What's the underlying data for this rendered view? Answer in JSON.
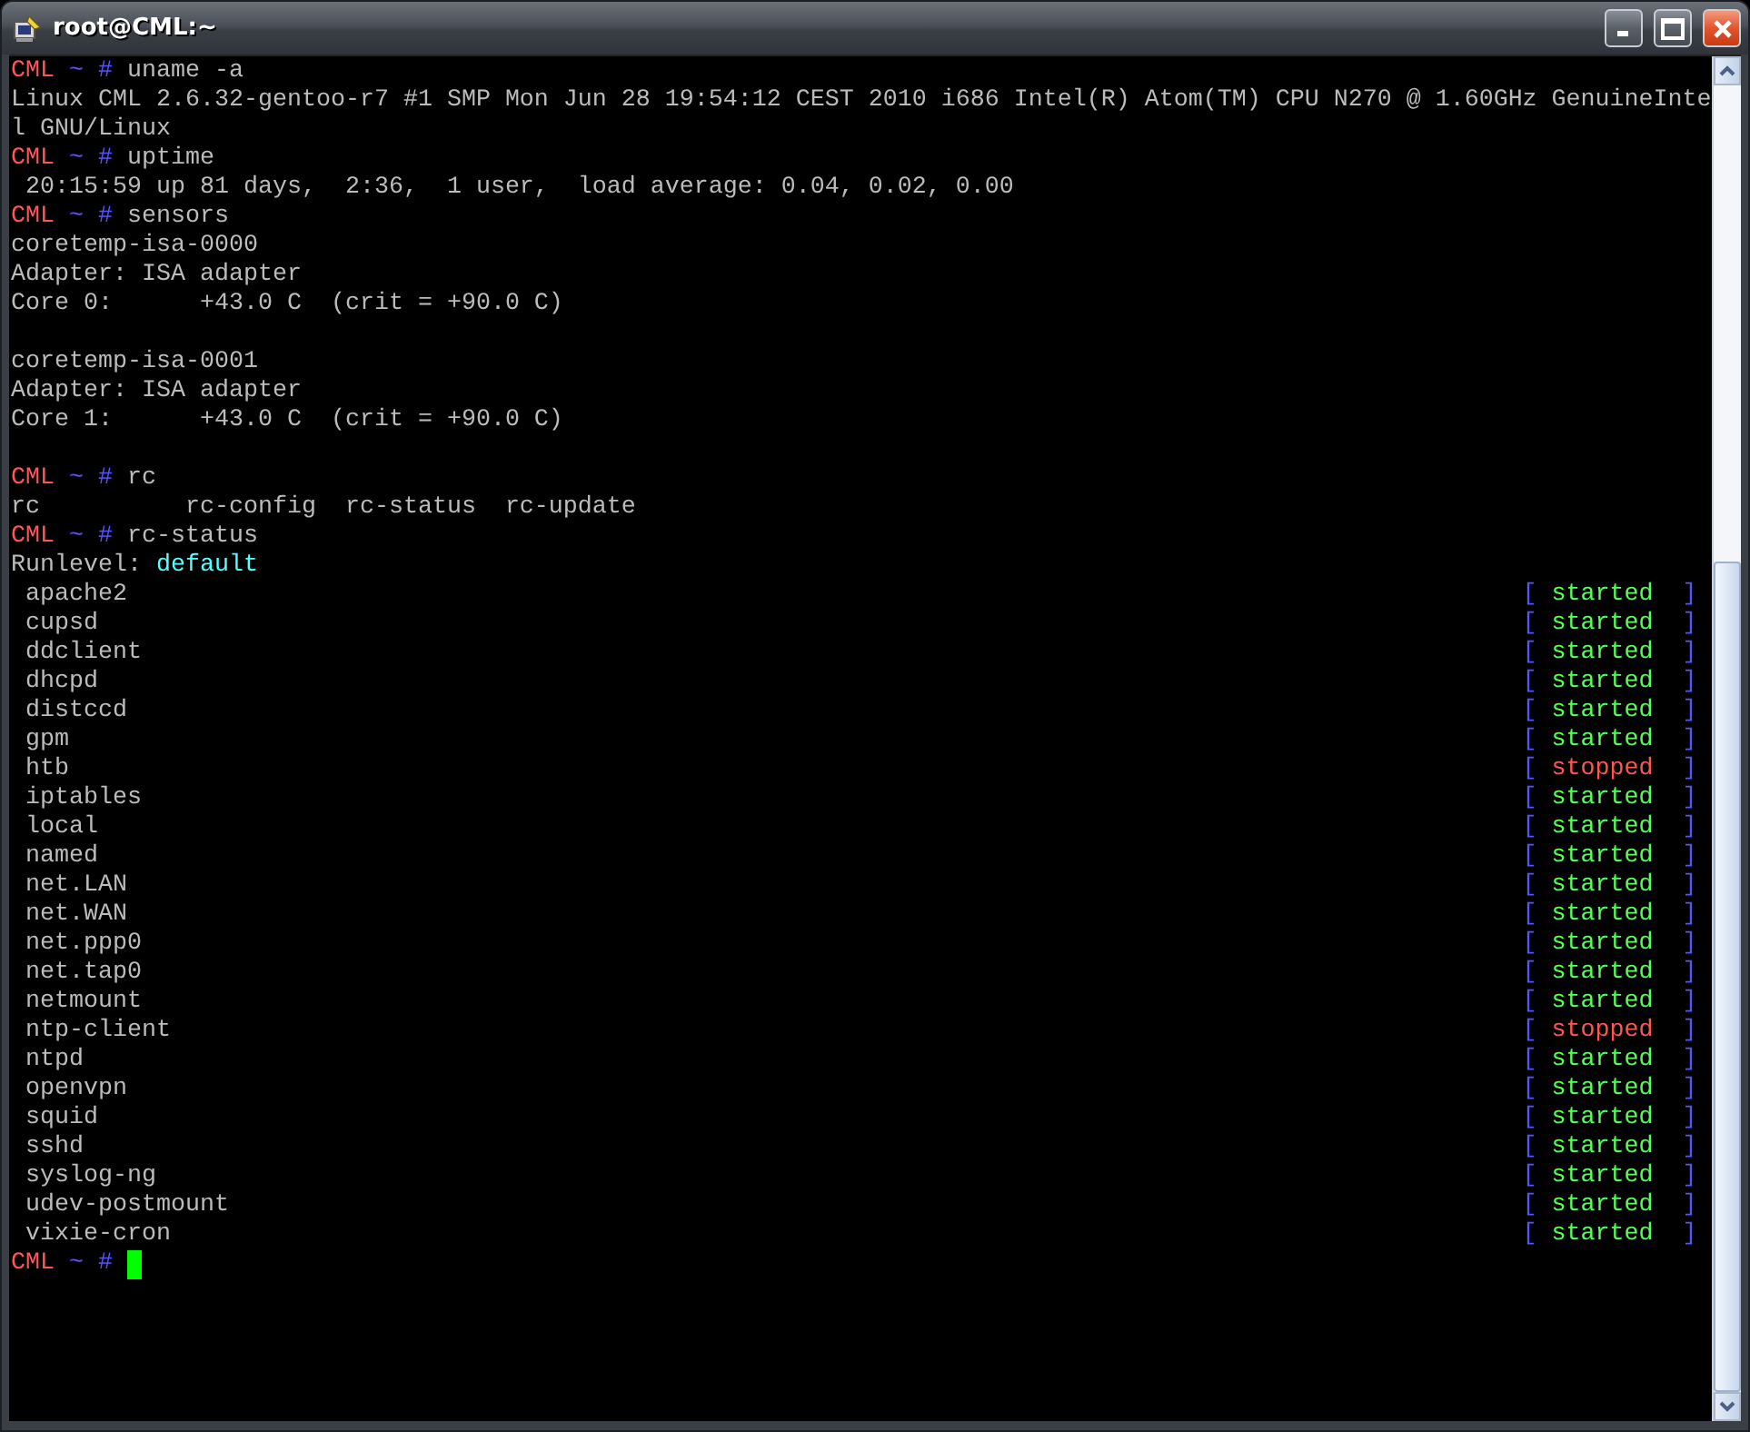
{
  "window": {
    "title": "root@CML:~"
  },
  "terminal": {
    "lines": [
      {
        "kind": "prompt",
        "host": "CML",
        "dir": "~",
        "sign": "#",
        "command": "uname -a"
      },
      {
        "kind": "output",
        "text": "Linux CML 2.6.32-gentoo-r7 #1 SMP Mon Jun 28 19:54:12 CEST 2010 i686 Intel(R) Atom(TM) CPU N270 @ 1.60GHz GenuineInte"
      },
      {
        "kind": "output",
        "text": "l GNU/Linux"
      },
      {
        "kind": "prompt",
        "host": "CML",
        "dir": "~",
        "sign": "#",
        "command": "uptime"
      },
      {
        "kind": "output",
        "text": " 20:15:59 up 81 days,  2:36,  1 user,  load average: 0.04, 0.02, 0.00"
      },
      {
        "kind": "prompt",
        "host": "CML",
        "dir": "~",
        "sign": "#",
        "command": "sensors"
      },
      {
        "kind": "output",
        "text": "coretemp-isa-0000"
      },
      {
        "kind": "output",
        "text": "Adapter: ISA adapter"
      },
      {
        "kind": "output",
        "text": "Core 0:      +43.0 C  (crit = +90.0 C)"
      },
      {
        "kind": "blank"
      },
      {
        "kind": "output",
        "text": "coretemp-isa-0001"
      },
      {
        "kind": "output",
        "text": "Adapter: ISA adapter"
      },
      {
        "kind": "output",
        "text": "Core 1:      +43.0 C  (crit = +90.0 C)"
      },
      {
        "kind": "blank"
      },
      {
        "kind": "prompt",
        "host": "CML",
        "dir": "~",
        "sign": "#",
        "command": "rc"
      },
      {
        "kind": "output",
        "text": "rc          rc-config  rc-status  rc-update"
      },
      {
        "kind": "prompt",
        "host": "CML",
        "dir": "~",
        "sign": "#",
        "command": "rc-status"
      },
      {
        "kind": "runlevel",
        "label": "Runlevel:",
        "value": "default"
      },
      {
        "kind": "service",
        "name": "apache2",
        "open": "[",
        "status": "started",
        "running": true,
        "close": "]"
      },
      {
        "kind": "service",
        "name": "cupsd",
        "open": "[",
        "status": "started",
        "running": true,
        "close": "]"
      },
      {
        "kind": "service",
        "name": "ddclient",
        "open": "[",
        "status": "started",
        "running": true,
        "close": "]"
      },
      {
        "kind": "service",
        "name": "dhcpd",
        "open": "[",
        "status": "started",
        "running": true,
        "close": "]"
      },
      {
        "kind": "service",
        "name": "distccd",
        "open": "[",
        "status": "started",
        "running": true,
        "close": "]"
      },
      {
        "kind": "service",
        "name": "gpm",
        "open": "[",
        "status": "started",
        "running": true,
        "close": "]"
      },
      {
        "kind": "service",
        "name": "htb",
        "open": "[",
        "status": "stopped",
        "running": false,
        "close": "]"
      },
      {
        "kind": "service",
        "name": "iptables",
        "open": "[",
        "status": "started",
        "running": true,
        "close": "]"
      },
      {
        "kind": "service",
        "name": "local",
        "open": "[",
        "status": "started",
        "running": true,
        "close": "]"
      },
      {
        "kind": "service",
        "name": "named",
        "open": "[",
        "status": "started",
        "running": true,
        "close": "]"
      },
      {
        "kind": "service",
        "name": "net.LAN",
        "open": "[",
        "status": "started",
        "running": true,
        "close": "]"
      },
      {
        "kind": "service",
        "name": "net.WAN",
        "open": "[",
        "status": "started",
        "running": true,
        "close": "]"
      },
      {
        "kind": "service",
        "name": "net.ppp0",
        "open": "[",
        "status": "started",
        "running": true,
        "close": "]"
      },
      {
        "kind": "service",
        "name": "net.tap0",
        "open": "[",
        "status": "started",
        "running": true,
        "close": "]"
      },
      {
        "kind": "service",
        "name": "netmount",
        "open": "[",
        "status": "started",
        "running": true,
        "close": "]"
      },
      {
        "kind": "service",
        "name": "ntp-client",
        "open": "[",
        "status": "stopped",
        "running": false,
        "close": "]"
      },
      {
        "kind": "service",
        "name": "ntpd",
        "open": "[",
        "status": "started",
        "running": true,
        "close": "]"
      },
      {
        "kind": "service",
        "name": "openvpn",
        "open": "[",
        "status": "started",
        "running": true,
        "close": "]"
      },
      {
        "kind": "service",
        "name": "squid",
        "open": "[",
        "status": "started",
        "running": true,
        "close": "]"
      },
      {
        "kind": "service",
        "name": "sshd",
        "open": "[",
        "status": "started",
        "running": true,
        "close": "]"
      },
      {
        "kind": "service",
        "name": "syslog-ng",
        "open": "[",
        "status": "started",
        "running": true,
        "close": "]"
      },
      {
        "kind": "service",
        "name": "udev-postmount",
        "open": "[",
        "status": "started",
        "running": true,
        "close": "]"
      },
      {
        "kind": "service",
        "name": "vixie-cron",
        "open": "[",
        "status": "started",
        "running": true,
        "close": "]"
      },
      {
        "kind": "prompt",
        "host": "CML",
        "dir": "~",
        "sign": "#",
        "cursor": true
      }
    ]
  }
}
